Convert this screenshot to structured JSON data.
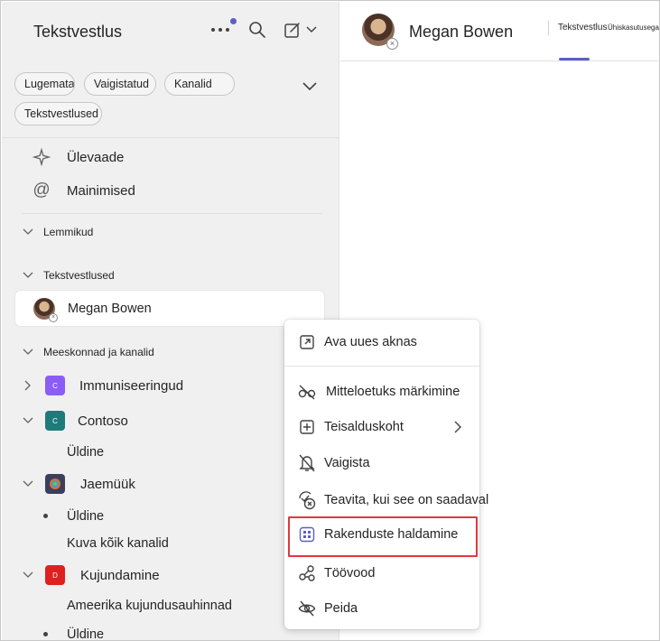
{
  "sidebar": {
    "title": "Tekstvestlus",
    "filters": [
      "Lugemata",
      "Vaigistatud",
      "Kanalid",
      "Tekstvestlused"
    ],
    "nav": [
      {
        "label": "Ülevaade",
        "icon": "sparkle-icon"
      },
      {
        "label": "Mainimised",
        "icon": "at-icon"
      }
    ],
    "sections": {
      "favorites": "Lemmikud",
      "chats": "Tekstvestlused",
      "teams": "Meeskonnad ja kanalid"
    },
    "chat": {
      "name": "Megan Bowen",
      "status": "offline"
    },
    "teams": [
      {
        "name": "Immuniseeringud",
        "tile_letter": "C",
        "tile_color": "#8b5cf6",
        "expanded": false
      },
      {
        "name": "Contoso",
        "tile_letter": "C",
        "tile_color": "#1f7a7a",
        "expanded": true,
        "channels": [
          "Üldine"
        ]
      },
      {
        "name": "Jaemüük",
        "tile_letter": "",
        "tile_color": "#3b3f5c",
        "expanded": true,
        "channels": [
          "Üldine",
          "Kuva kõik kanalid"
        ]
      },
      {
        "name": "Kujundamine",
        "tile_letter": "D",
        "tile_color": "#e02020",
        "expanded": true,
        "channels": [
          "Ameerika kujundusauhinnad",
          "Üldine"
        ]
      }
    ]
  },
  "header": {
    "contact": "Megan Bowen",
    "tabs": [
      "Tekstvestlus",
      "Ühiskasutusega"
    ],
    "active_tab": "Tekstvestlus",
    "accent": "#5b5fc7"
  },
  "context_menu": {
    "items": [
      {
        "label": "Ava uues aknas",
        "icon": "open-in-new-window-icon"
      },
      {
        "label": "Mitteloetuks märkimine",
        "icon": "glasses-off-icon"
      },
      {
        "label": "Teisalduskoht",
        "icon": "add-square-icon",
        "has_submenu": true
      },
      {
        "label": "Vaigista",
        "icon": "bell-off-icon"
      },
      {
        "label": "Teavita, kui see on saadaval",
        "icon": "availability-notify-icon"
      },
      {
        "label": "Rakenduste haldamine",
        "icon": "apps-grid-icon",
        "highlighted": true
      },
      {
        "label": "Töövood",
        "icon": "workflows-icon"
      },
      {
        "label": "Peida",
        "icon": "eye-off-icon"
      }
    ],
    "highlight_color": "#e0393e"
  }
}
